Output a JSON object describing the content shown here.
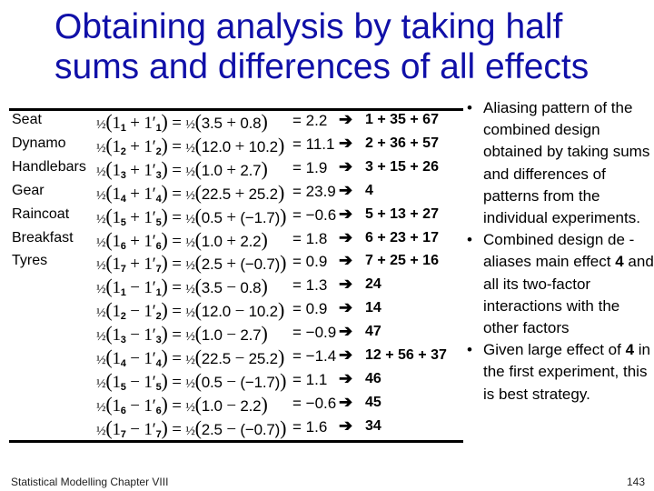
{
  "title": "Obtaining analysis by taking half sums and differences of all effects",
  "table": {
    "sum_rows": [
      {
        "factor": "Seat",
        "index": "1",
        "a": "3.5",
        "b": "0.8",
        "result": "2.2",
        "alias": "1 + 35 + 67"
      },
      {
        "factor": "Dynamo",
        "index": "2",
        "a": "12.0",
        "b": "10.2",
        "result": "11.1",
        "alias": "2 + 36 + 57"
      },
      {
        "factor": "Handlebars",
        "index": "3",
        "a": "1.0",
        "b": "2.7",
        "result": "1.9",
        "alias": "3 + 15 + 26"
      },
      {
        "factor": "Gear",
        "index": "4",
        "a": "22.5",
        "b": "25.2",
        "result": "23.9",
        "alias": "4"
      },
      {
        "factor": "Raincoat",
        "index": "5",
        "a": "0.5",
        "b": "(−1.7)",
        "result": "−0.6",
        "alias": "5 + 13 + 27"
      },
      {
        "factor": "Breakfast",
        "index": "6",
        "a": "1.0",
        "b": "2.2",
        "result": "1.8",
        "alias": "6 + 23 + 17"
      },
      {
        "factor": "Tyres",
        "index": "7",
        "a": "2.5",
        "b": "(−0.7)",
        "result": "0.9",
        "alias": "7 + 25 + 16"
      }
    ],
    "diff_rows": [
      {
        "index": "1",
        "a": "3.5",
        "b": "0.8",
        "result": "1.3",
        "alias": "24"
      },
      {
        "index": "2",
        "a": "12.0",
        "b": "10.2",
        "result": "0.9",
        "alias": "14"
      },
      {
        "index": "3",
        "a": "1.0",
        "b": "2.7",
        "result": "−0.9",
        "alias": "47"
      },
      {
        "index": "4",
        "a": "22.5",
        "b": "25.2",
        "result": "−1.4",
        "alias": "12 + 56 + 37"
      },
      {
        "index": "5",
        "a": "0.5",
        "b": "(−1.7)",
        "result": "1.1",
        "alias": "46"
      },
      {
        "index": "6",
        "a": "1.0",
        "b": "2.2",
        "result": "−0.6",
        "alias": "45"
      },
      {
        "index": "7",
        "a": "2.5",
        "b": "(−0.7)",
        "result": "1.6",
        "alias": "34"
      }
    ],
    "arrow_icon": "right-arrow"
  },
  "bullets": [
    {
      "parts": [
        {
          "text": "Aliasing pattern of the combined design obtained by taking sums and differences of patterns from the individual experiments.",
          "bold": false
        }
      ]
    },
    {
      "parts": [
        {
          "text": "Combined design de -aliases main effect ",
          "bold": false
        },
        {
          "text": "4",
          "bold": true
        },
        {
          "text": " and all its two-factor interactions with the other factors",
          "bold": false
        }
      ]
    },
    {
      "parts": [
        {
          "text": "Given large effect of ",
          "bold": false
        },
        {
          "text": "4",
          "bold": true
        },
        {
          "text": " in the first experiment, this is best strategy.",
          "bold": false
        }
      ]
    }
  ],
  "footer": {
    "left": "Statistical Modelling   Chapter VIII",
    "page": "143"
  }
}
